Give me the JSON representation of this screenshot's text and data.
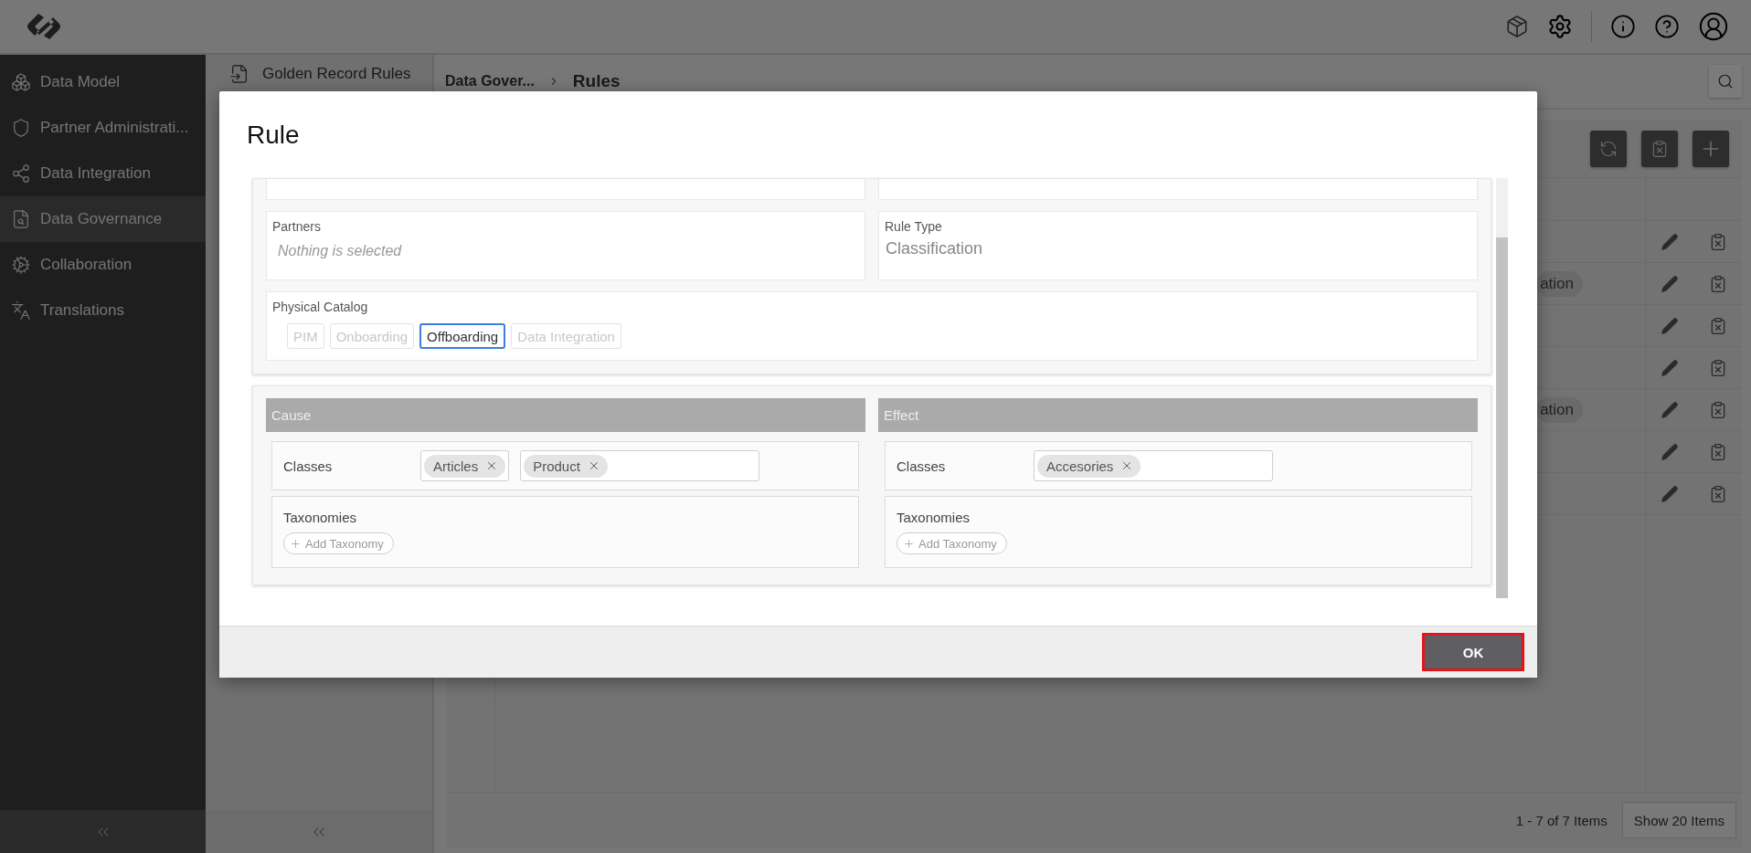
{
  "sidebar": {
    "items": [
      {
        "label": "Data Model",
        "selected": false
      },
      {
        "label": "Partner Administrati...",
        "selected": false
      },
      {
        "label": "Data Integration",
        "selected": false
      },
      {
        "label": "Data Governance",
        "selected": true
      },
      {
        "label": "Collaboration",
        "selected": false
      },
      {
        "label": "Translations",
        "selected": false
      }
    ]
  },
  "subnav": {
    "items": [
      {
        "label": "Golden Record Rules"
      }
    ]
  },
  "breadcrumb": {
    "parent": "Data Gover...",
    "current": "Rules"
  },
  "table": {
    "rows": [
      {},
      {
        "tag": "ation"
      },
      {},
      {},
      {
        "tag": "ation"
      },
      {},
      {}
    ]
  },
  "pager": {
    "summary": "1 - 7 of 7 Items",
    "page_size_button": "Show 20 Items"
  },
  "modal": {
    "title": "Rule",
    "partners": {
      "label": "Partners",
      "placeholder": "Nothing is selected"
    },
    "rule_type": {
      "label": "Rule Type",
      "value": "Classification"
    },
    "physical_catalog": {
      "label": "Physical Catalog",
      "options": [
        {
          "label": "PIM",
          "selected": false
        },
        {
          "label": "Onboarding",
          "selected": false
        },
        {
          "label": "Offboarding",
          "selected": true
        },
        {
          "label": "Data Integration",
          "selected": false
        }
      ]
    },
    "sections": [
      {
        "title": "Cause",
        "classes_label": "Classes",
        "class_groups": [
          [
            "Articles"
          ],
          [
            "Product"
          ]
        ],
        "taxonomies_label": "Taxonomies",
        "add_button": "Add Taxonomy"
      },
      {
        "title": "Effect",
        "classes_label": "Classes",
        "class_groups": [
          [
            "Accesories"
          ]
        ],
        "taxonomies_label": "Taxonomies",
        "add_button": "Add Taxonomy"
      }
    ],
    "ok_button": "OK"
  }
}
